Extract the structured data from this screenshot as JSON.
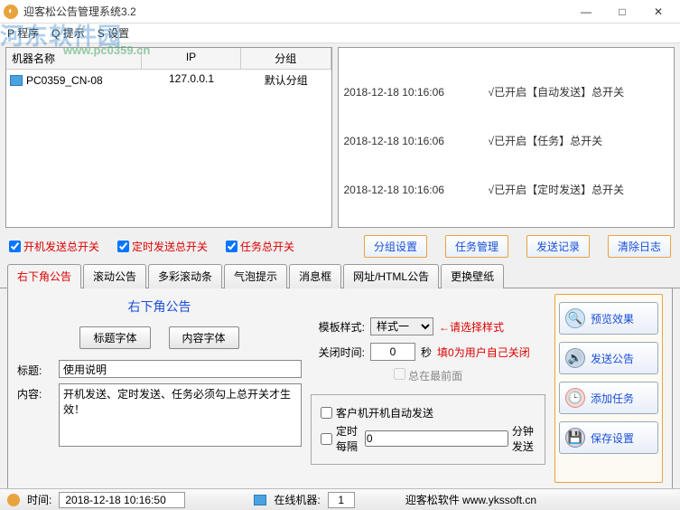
{
  "window": {
    "title": "迎客松公告管理系统3.2",
    "min": "—",
    "max": "□",
    "close": "✕"
  },
  "menu": {
    "program": "P 程序",
    "tips": "Q 提示",
    "settings": "S 设置"
  },
  "watermark": "河东软件园",
  "watermark_url": "www.pc0359.cn",
  "machinelist": {
    "headers": {
      "name": "机器名称",
      "ip": "IP",
      "group": "分组"
    },
    "rows": [
      {
        "name": "PC0359_CN-08",
        "ip": "127.0.0.1",
        "group": "默认分组"
      }
    ]
  },
  "log": [
    {
      "time": "2018-12-18 10:16:06",
      "msg": "√已开启【自动发送】总开关"
    },
    {
      "time": "2018-12-18 10:16:06",
      "msg": "√已开启【任务】总开关"
    },
    {
      "time": "2018-12-18 10:16:06",
      "msg": "√已开启【定时发送】总开关"
    }
  ],
  "switches": {
    "boot": "开机发送总开关",
    "timer": "定时发送总开关",
    "task": "任务总开关"
  },
  "actions": {
    "group": "分组设置",
    "taskmgr": "任务管理",
    "sendlog": "发送记录",
    "clearlog": "清除日志"
  },
  "tabs": [
    "右下角公告",
    "滚动公告",
    "多彩滚动条",
    "气泡提示",
    "消息框",
    "网址/HTML公告",
    "更换壁纸"
  ],
  "form": {
    "heading": "右下角公告",
    "titlefont_btn": "标题字体",
    "contentfont_btn": "内容字体",
    "title_lbl": "标题:",
    "title_val": "使用说明",
    "content_lbl": "内容:",
    "content_val": "开机发送、定时发送、任务必须勾上总开关才生效！",
    "template_lbl": "模板样式:",
    "template_val": "样式一",
    "template_hint": "←请选择样式",
    "closetime_lbl": "关闭时间:",
    "closetime_val": "0",
    "closetime_unit": "秒",
    "closetime_hint": "填0为用户自己关闭",
    "topmost": "总在最前面",
    "autosend": "客户机开机自动发送",
    "timed_lbl": "定时   每隔",
    "timed_val": "0",
    "timed_unit": "分钟发送"
  },
  "bigbuttons": {
    "preview": "预览效果",
    "send": "发送公告",
    "addtask": "添加任务",
    "save": "保存设置"
  },
  "status": {
    "time_lbl": "时间:",
    "time_val": "2018-12-18 10:16:50",
    "online_lbl": "在线机器:",
    "online_val": "1",
    "brand": "迎客松软件 www.ykssoft.cn"
  }
}
